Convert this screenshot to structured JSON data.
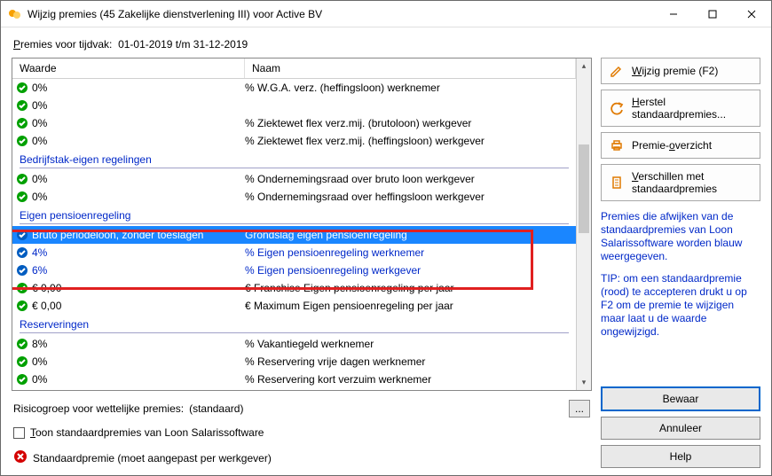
{
  "window": {
    "title": "Wijzig premies (45 Zakelijke dienstverlening III) voor Active BV"
  },
  "tijdvak": {
    "prefix_u": "P",
    "prefix_rest": "remies voor tijdvak:",
    "value": "01-01-2019 t/m 31-12-2019"
  },
  "columns": {
    "waarde": "Waarde",
    "naam": "Naam"
  },
  "groups": {
    "bedrijf": "Bedrijfstak-eigen regelingen",
    "eigen": "Eigen pensioenregeling",
    "reserv": "Reserveringen"
  },
  "rows": {
    "r1": {
      "val": "0%",
      "naam": "% W.G.A. verz. (heffingsloon) werknemer"
    },
    "r2": {
      "val": "0%",
      "naam": ""
    },
    "r3": {
      "val": "0%",
      "naam": "% Ziektewet flex verz.mij. (brutoloon) werkgever"
    },
    "r4": {
      "val": "0%",
      "naam": "% Ziektewet flex verz.mij. (heffingsloon) werkgever"
    },
    "r5": {
      "val": "0%",
      "naam": "% Ondernemingsraad over bruto loon werkgever"
    },
    "r6": {
      "val": "0%",
      "naam": "% Ondernemingsraad over heffingsloon werkgever"
    },
    "r7": {
      "val": "Bruto periodeloon, zonder toeslagen",
      "naam": "Grondslag eigen pensioenregeling"
    },
    "r8": {
      "val": "4%",
      "naam": "% Eigen pensioenregeling werknemer"
    },
    "r9": {
      "val": "6%",
      "naam": "% Eigen pensioenregeling werkgever"
    },
    "r10": {
      "val": "€ 0,00",
      "naam": "€ Franchise Eigen pensioenregeling per jaar"
    },
    "r11": {
      "val": "€ 0,00",
      "naam": "€ Maximum Eigen pensioenregeling per jaar"
    },
    "r12": {
      "val": "8%",
      "naam": "% Vakantiegeld werknemer"
    },
    "r13": {
      "val": "0%",
      "naam": "% Reservering vrije dagen werknemer"
    },
    "r14": {
      "val": "0%",
      "naam": "% Reservering kort verzuim werknemer"
    }
  },
  "riskrow": {
    "label": "Risicogroep voor wettelijke premies:",
    "value": "(standaard)"
  },
  "checkline": {
    "u": "T",
    "rest": "oon standaardpremies van Loon Salarissoftware"
  },
  "errline": "Standaardpremie (moet aangepast per werkgever)",
  "rbuttons": {
    "wijzig": {
      "u": "W",
      "rest": "ijzig premie (F2)"
    },
    "herstel": {
      "u": "H",
      "rest": "erstel standaardpremies..."
    },
    "overzicht": {
      "pre": "Premie-",
      "u": "o",
      "rest": "verzicht"
    },
    "verschillen": {
      "u": "V",
      "rest": "erschillen met standaardpremies"
    }
  },
  "notes": {
    "blue": "Premies die afwijken van de standaardpremies van Loon Salarissoftware worden blauw weergegeven.",
    "black": "TIP: om een standaardpremie (rood) te accepteren drukt u op F2 om de premie te wijzigen maar laat u de waarde ongewijzigd."
  },
  "bottom": {
    "bewaar": "Bewaar",
    "annuleer": "Annuleer",
    "help": "Help"
  }
}
